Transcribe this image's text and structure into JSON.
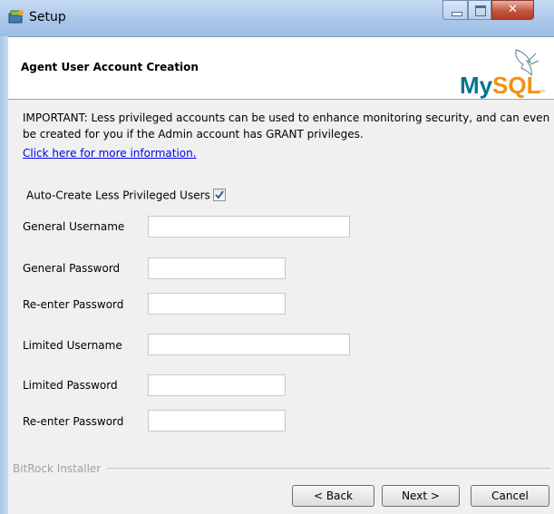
{
  "window": {
    "title": "Setup"
  },
  "header": {
    "title": "Agent User Account Creation",
    "logo": {
      "text_my": "My",
      "text_sql": "SQL",
      "tm": "™"
    }
  },
  "info": {
    "text": "IMPORTANT: Less privileged accounts can be used to enhance monitoring security, and can even be created for you if the Admin account has GRANT privileges.",
    "link": "Click here for more information."
  },
  "auto_create": {
    "label": "Auto-Create Less Privileged Users",
    "checked": true
  },
  "fields": {
    "general_username": {
      "label": "General Username",
      "value": ""
    },
    "general_password": {
      "label": "General Password",
      "value": ""
    },
    "general_reenter": {
      "label": "Re-enter Password",
      "value": ""
    },
    "limited_username": {
      "label": "Limited Username",
      "value": ""
    },
    "limited_password": {
      "label": "Limited Password",
      "value": ""
    },
    "limited_reenter": {
      "label": "Re-enter Password",
      "value": ""
    }
  },
  "footer": {
    "installer": "BitRock Installer",
    "back": "< Back",
    "next": "Next >",
    "cancel": "Cancel"
  },
  "colors": {
    "mysql_blue": "#00758f",
    "mysql_orange": "#f29111",
    "link": "#0000ee"
  }
}
